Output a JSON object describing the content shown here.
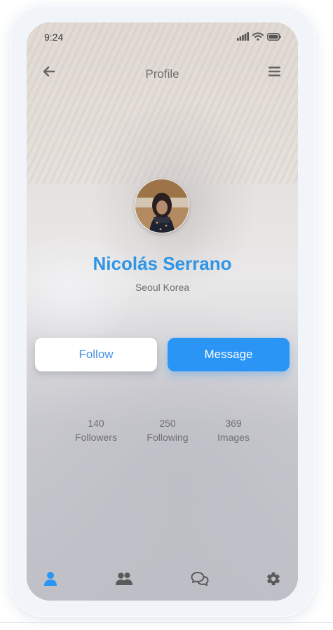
{
  "status_bar": {
    "time": "9:24",
    "icons": [
      "signal-icon",
      "wifi-icon",
      "battery-icon"
    ]
  },
  "header": {
    "title": "Profile",
    "back_icon": "arrow-left-icon",
    "menu_icon": "hamburger-menu-icon"
  },
  "profile": {
    "name": "Nicolás Serrano",
    "location": "Seoul Korea"
  },
  "actions": {
    "follow_label": "Follow",
    "message_label": "Message"
  },
  "stats": [
    {
      "value": "140",
      "label": "Followers"
    },
    {
      "value": "250",
      "label": "Following"
    },
    {
      "value": "369",
      "label": "Images"
    }
  ],
  "bottom_nav": {
    "items": [
      {
        "icon": "user-icon",
        "active": true
      },
      {
        "icon": "users-icon",
        "active": false
      },
      {
        "icon": "chat-icon",
        "active": false
      },
      {
        "icon": "gear-icon",
        "active": false
      }
    ]
  },
  "colors": {
    "accent": "#2b95f5",
    "name_color": "#2f95e8",
    "nav_active": "#2b95f5",
    "nav_inactive": "#5a5a5a"
  }
}
